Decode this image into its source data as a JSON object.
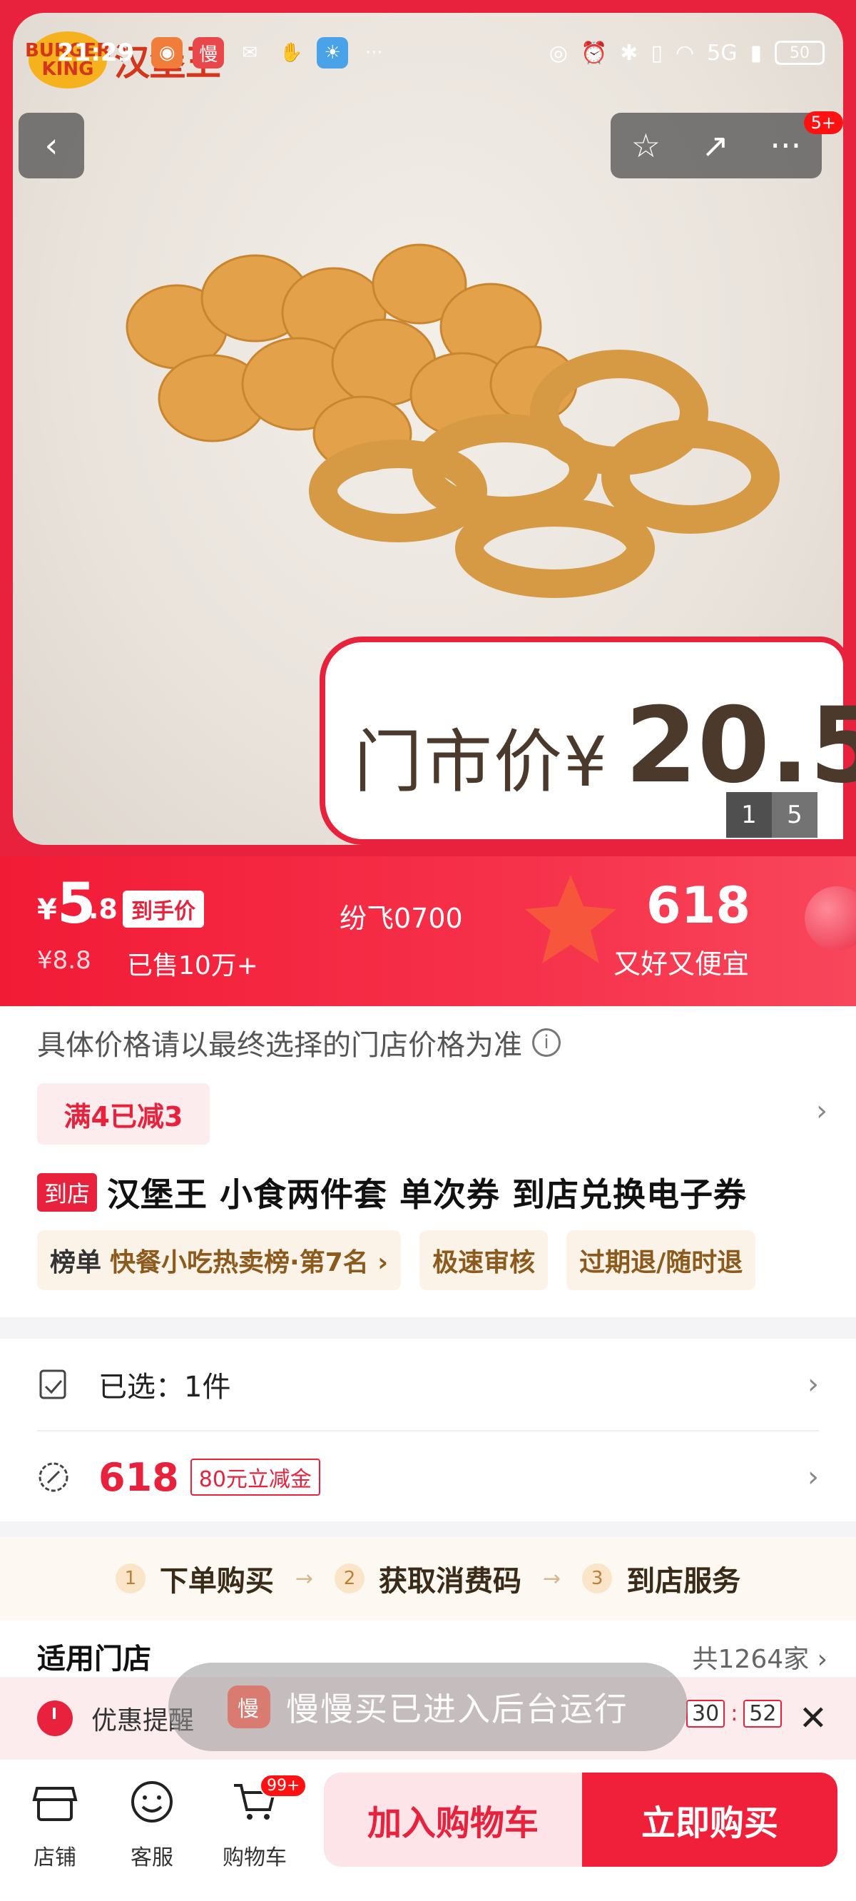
{
  "status_bar": {
    "time": "21:29",
    "signal": "5G",
    "battery": "50"
  },
  "brand": {
    "logo_text": "BURGER KING",
    "name_cn": "汉堡王"
  },
  "hero": {
    "notification_badge": "5+",
    "price_card_label": "门市价¥",
    "price_card_value": "20.5",
    "pager_current": "1",
    "pager_total": "5"
  },
  "price_bar": {
    "currency": "¥",
    "price_int": "5",
    "price_dec": ".8",
    "price_tag": "到手价",
    "original_price": "¥8.8",
    "sold": "已售10万+",
    "center_text": "纷飞0700",
    "promo_number": "618",
    "promo_sub": "又好又便宜"
  },
  "info": {
    "price_note": "具体价格请以最终选择的门店价格为准",
    "discount_chip": "满4已减3",
    "store_tag": "到店",
    "product_title": "汉堡王 小食两件套 单次券 到店兑换电子券",
    "tags": [
      {
        "strong": "榜单",
        "text": "快餐小吃热卖榜·第7名 ›"
      },
      {
        "strong": "",
        "text": "极速审核"
      },
      {
        "strong": "",
        "text": "过期退/随时退"
      }
    ]
  },
  "rows": {
    "selected": "已选：1件",
    "promo_number": "618",
    "coupon": "80元立减金"
  },
  "steps": [
    {
      "num": "1",
      "label": "下单购买"
    },
    {
      "num": "2",
      "label": "获取消费码"
    },
    {
      "num": "3",
      "label": "到店服务"
    }
  ],
  "stores": {
    "label": "适用门店",
    "count": "共1264家 ›"
  },
  "reminder": {
    "text": "优惠提醒",
    "minutes": "30",
    "seconds": "52"
  },
  "toast": {
    "icon_text": "慢",
    "message": "慢慢买已进入后台运行"
  },
  "bottom_bar": {
    "shop": "店铺",
    "service": "客服",
    "cart": "购物车",
    "cart_badge": "99+",
    "add_to_cart": "加入购物车",
    "buy_now": "立即购买"
  },
  "colors": {
    "brand_red": "#e8213c",
    "tag_brown": "#8b5a1c"
  }
}
